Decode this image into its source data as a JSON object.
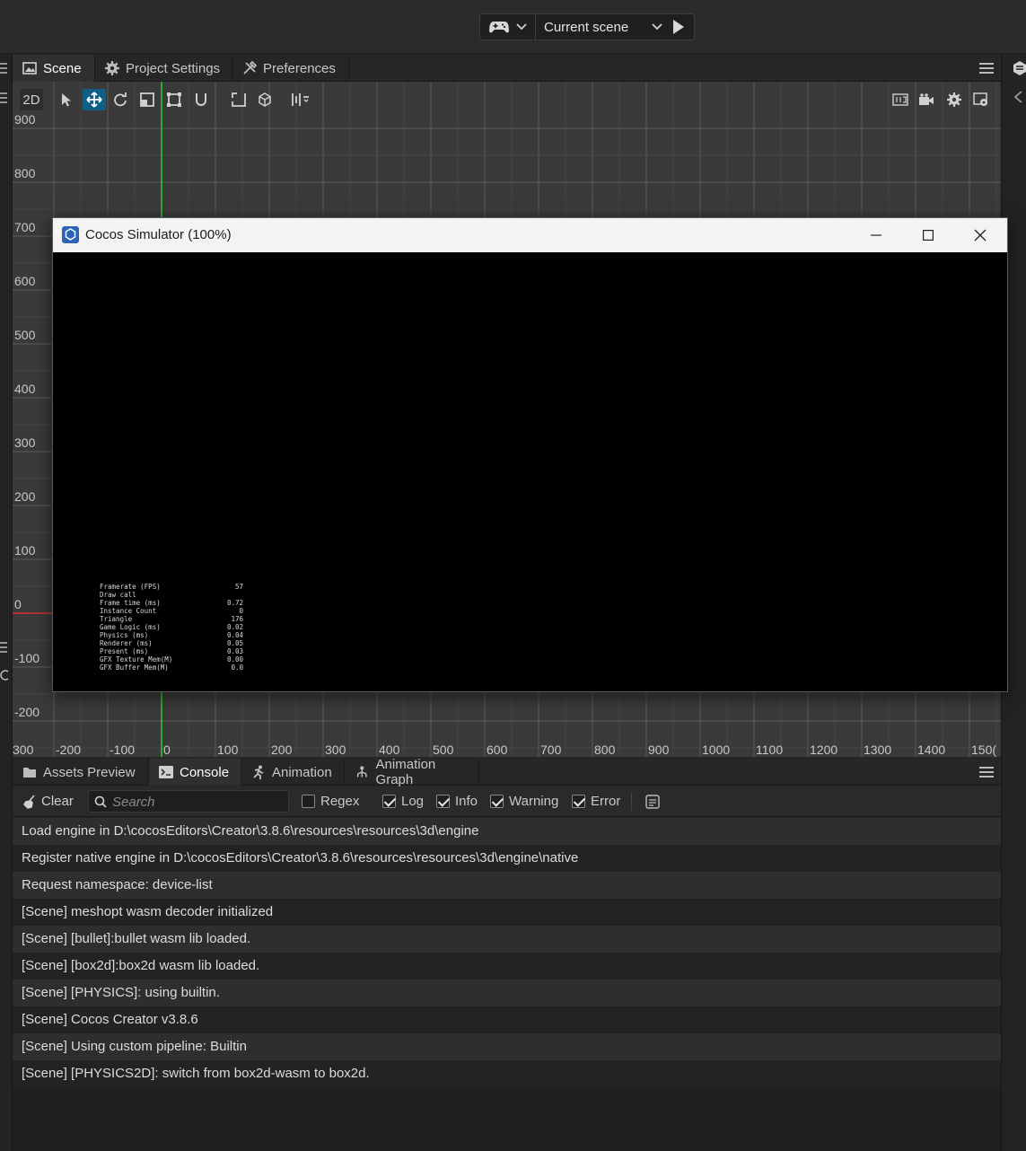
{
  "toolbar": {
    "scene_select_label": "Current scene"
  },
  "scene_panel": {
    "tabs": [
      {
        "label": "Scene",
        "icon": "scene-icon"
      },
      {
        "label": "Project Settings",
        "icon": "gear-icon"
      },
      {
        "label": "Preferences",
        "icon": "tools-icon"
      }
    ],
    "mode_2d_label": "2D",
    "y_axis_labels": [
      "900",
      "800",
      "700",
      "600",
      "500",
      "400",
      "300",
      "200",
      "100",
      "0",
      "-100",
      "-200"
    ],
    "x_axis_labels": [
      "300",
      "-200",
      "-100",
      "0",
      "100",
      "200",
      "300",
      "400",
      "500",
      "600",
      "700",
      "800",
      "900",
      "1000",
      "1100",
      "1200",
      "1300",
      "1400",
      "150("
    ]
  },
  "simulator": {
    "title": "Cocos Simulator (100%)",
    "stats": [
      {
        "label": "Framerate (FPS)",
        "value": "57"
      },
      {
        "label": "Draw call",
        "value": ""
      },
      {
        "label": "Frame time (ms)",
        "value": "0.72"
      },
      {
        "label": "Instance Count",
        "value": "0"
      },
      {
        "label": "Triangle",
        "value": "176"
      },
      {
        "label": "Game Logic (ms)",
        "value": "0.02"
      },
      {
        "label": "Physics (ms)",
        "value": "0.04"
      },
      {
        "label": "Renderer (ms)",
        "value": "0.05"
      },
      {
        "label": "Present (ms)",
        "value": "0.03"
      },
      {
        "label": "GFX Texture Mem(M)",
        "value": "0.00"
      },
      {
        "label": "GFX Buffer Mem(M)",
        "value": "0.0"
      }
    ]
  },
  "bottom_panel": {
    "tabs": [
      {
        "label": "Assets Preview",
        "icon": "folder-icon"
      },
      {
        "label": "Console",
        "icon": "terminal-icon"
      },
      {
        "label": "Animation",
        "icon": "running-man-icon"
      },
      {
        "label": "Animation Graph",
        "icon": "graph-icon"
      }
    ],
    "clear_label": "Clear",
    "search_placeholder": "Search",
    "filters": [
      {
        "label": "Regex",
        "checked": false
      },
      {
        "label": "Log",
        "checked": true
      },
      {
        "label": "Info",
        "checked": true
      },
      {
        "label": "Warning",
        "checked": true
      },
      {
        "label": "Error",
        "checked": true
      }
    ],
    "logs": [
      "Load engine in D:\\cocosEditors\\Creator\\3.8.6\\resources\\resources\\3d\\engine",
      "Register native engine in D:\\cocosEditors\\Creator\\3.8.6\\resources\\resources\\3d\\engine\\native",
      "Request namespace: device-list",
      "[Scene] meshopt wasm decoder initialized",
      "[Scene] [bullet]:bullet wasm lib loaded.",
      "[Scene] [box2d]:box2d wasm lib loaded.",
      "[Scene] [PHYSICS]: using builtin.",
      "[Scene] Cocos Creator v3.8.6",
      "[Scene] Using custom pipeline: Builtin",
      "[Scene] [PHYSICS2D]: switch from box2d-wasm to box2d."
    ]
  }
}
